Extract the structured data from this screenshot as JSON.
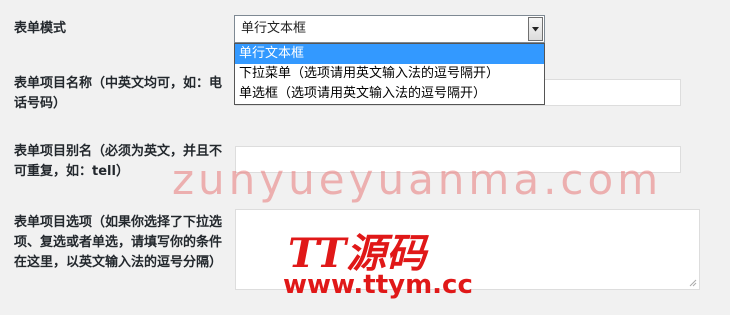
{
  "form": {
    "mode_label": "表单模式",
    "mode_select": {
      "selected": "单行文本框",
      "options": [
        "单行文本框",
        "下拉菜单（选项请用英文输入法的逗号隔开）",
        "单选框（选项请用英文输入法的逗号隔开）"
      ]
    },
    "item_name_label": "表单项目名称（中英文均可，如：电话号码）",
    "item_alias_label": "表单项目别名（必须为英文，并且不可重复，如：tell）",
    "item_options_label": "表单项目选项（如果你选择了下拉选项、复选或者单选，请填写你的条件在这里，以英文输入法的逗号分隔）"
  },
  "watermark": {
    "text": "zunyueyuanma.com",
    "logo_title": "TT源码",
    "logo_url": "www.ttym.cc"
  }
}
